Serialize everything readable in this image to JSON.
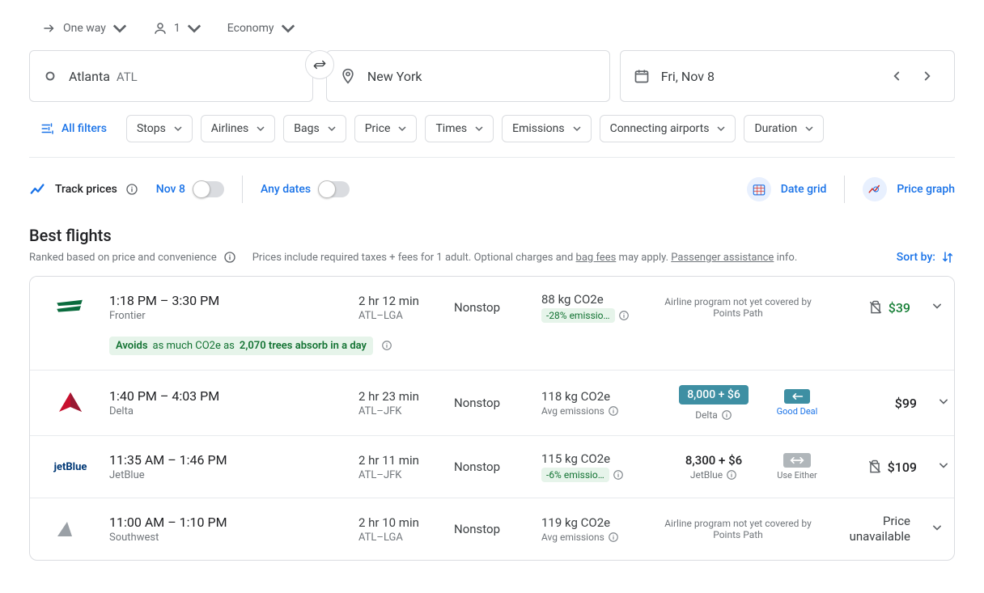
{
  "tripOptions": {
    "tripType": "One way",
    "passengers": "1",
    "cabin": "Economy"
  },
  "search": {
    "origin": "Atlanta",
    "originCode": "ATL",
    "destination": "New York",
    "date": "Fri, Nov 8"
  },
  "filters": {
    "all": "All filters",
    "chips": [
      "Stops",
      "Airlines",
      "Bags",
      "Price",
      "Times",
      "Emissions",
      "Connecting airports",
      "Duration"
    ]
  },
  "tracking": {
    "label": "Track prices",
    "date": "Nov 8",
    "anyDates": "Any dates",
    "dateGrid": "Date grid",
    "priceGraph": "Price graph"
  },
  "section": {
    "title": "Best flights",
    "ranked": "Ranked based on price and convenience",
    "pricesNote1": "Prices include required taxes + fees for 1 adult. Optional charges and ",
    "bagFees": "bag fees",
    "pricesNote2": " may apply. ",
    "passengerAssist": "Passenger assistance",
    "infoSuffix": " info.",
    "sortBy": "Sort by:"
  },
  "flights": [
    {
      "id": "frontier",
      "times": "1:18 PM – 3:30 PM",
      "airline": "Frontier",
      "duration": "2 hr 12 min",
      "route": "ATL–LGA",
      "stops": "Nonstop",
      "co2": "88 kg CO2e",
      "co2Badge": "-28% emissio…",
      "pointsNote": "Airline program not yet covered by Points Path",
      "price": "$39",
      "envNote": {
        "prefix": "Avoids",
        "mid": " as much CO2e as ",
        "bold": "2,070 trees absorb in a day"
      }
    },
    {
      "id": "delta",
      "times": "1:40 PM – 4:03 PM",
      "airline": "Delta",
      "duration": "2 hr 23 min",
      "route": "ATL–JFK",
      "stops": "Nonstop",
      "co2": "118 kg CO2e",
      "co2Sub": "Avg emissions",
      "pointsBadge": "8,000 + $6",
      "pointsProgram": "Delta",
      "dealLabel": "Good Deal",
      "price": "$99"
    },
    {
      "id": "jetblue",
      "times": "11:35 AM – 1:46 PM",
      "airline": "JetBlue",
      "duration": "2 hr 11 min",
      "route": "ATL–JFK",
      "stops": "Nonstop",
      "co2": "115 kg CO2e",
      "co2Badge": "-6% emissio…",
      "pointsText": "8,300 + $6",
      "pointsProgram": "JetBlue",
      "dealLabel": "Use Either",
      "price": "$109"
    },
    {
      "id": "southwest",
      "times": "11:00 AM – 1:10 PM",
      "airline": "Southwest",
      "duration": "2 hr 10 min",
      "route": "ATL–LGA",
      "stops": "Nonstop",
      "co2": "119 kg CO2e",
      "co2Sub": "Avg emissions",
      "pointsNote": "Airline program not yet covered by Points Path",
      "priceUnavail": "Price unavailable"
    }
  ]
}
